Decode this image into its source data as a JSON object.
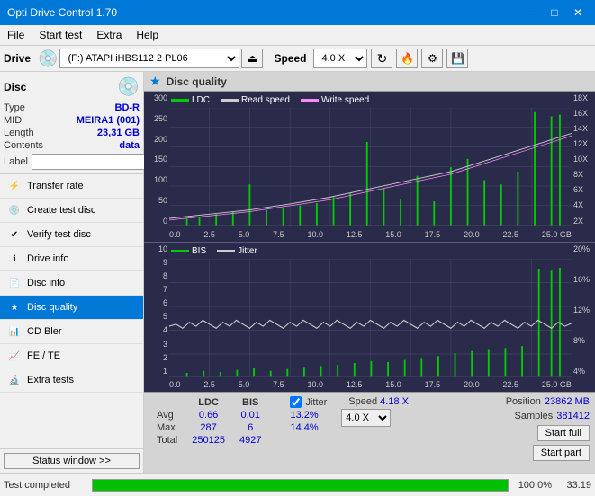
{
  "titlebar": {
    "title": "Opti Drive Control 1.70",
    "minimize": "─",
    "maximize": "□",
    "close": "✕"
  },
  "menubar": {
    "items": [
      "File",
      "Start test",
      "Extra",
      "Help"
    ]
  },
  "toolbar": {
    "drive_label": "Drive",
    "drive_value": "(F:)  ATAPI iHBS112  2 PL06",
    "speed_label": "Speed",
    "speed_value": "4.0 X"
  },
  "disc": {
    "header": "Disc",
    "type_label": "Type",
    "type_value": "BD-R",
    "mid_label": "MID",
    "mid_value": "MEIRA1 (001)",
    "length_label": "Length",
    "length_value": "23,31 GB",
    "contents_label": "Contents",
    "contents_value": "data",
    "label_label": "Label",
    "label_value": ""
  },
  "nav": {
    "items": [
      {
        "id": "transfer-rate",
        "label": "Transfer rate",
        "icon": "⚡"
      },
      {
        "id": "create-test-disc",
        "label": "Create test disc",
        "icon": "💿"
      },
      {
        "id": "verify-test-disc",
        "label": "Verify test disc",
        "icon": "✔"
      },
      {
        "id": "drive-info",
        "label": "Drive info",
        "icon": "ℹ"
      },
      {
        "id": "disc-info",
        "label": "Disc info",
        "icon": "📄"
      },
      {
        "id": "disc-quality",
        "label": "Disc quality",
        "icon": "★",
        "active": true
      },
      {
        "id": "cd-bler",
        "label": "CD Bler",
        "icon": "📊"
      },
      {
        "id": "fe-te",
        "label": "FE / TE",
        "icon": "📈"
      },
      {
        "id": "extra-tests",
        "label": "Extra tests",
        "icon": "🔬"
      }
    ]
  },
  "chart": {
    "title": "Disc quality",
    "top": {
      "legend": [
        {
          "label": "LDC",
          "color": "#00cc00"
        },
        {
          "label": "Read speed",
          "color": "#cccccc"
        },
        {
          "label": "Write speed",
          "color": "#ff88ff"
        }
      ],
      "y_left": [
        "300",
        "250",
        "200",
        "150",
        "100",
        "50",
        "0"
      ],
      "y_right": [
        "18X",
        "16X",
        "14X",
        "12X",
        "10X",
        "8X",
        "6X",
        "4X",
        "2X"
      ],
      "x_labels": [
        "0.0",
        "2.5",
        "5.0",
        "7.5",
        "10.0",
        "12.5",
        "15.0",
        "17.5",
        "20.0",
        "22.5",
        "25.0 GB"
      ]
    },
    "bottom": {
      "legend": [
        {
          "label": "BIS",
          "color": "#00cc00"
        },
        {
          "label": "Jitter",
          "color": "#cccccc"
        }
      ],
      "y_left": [
        "10",
        "9",
        "8",
        "7",
        "6",
        "5",
        "4",
        "3",
        "2",
        "1"
      ],
      "y_right": [
        "20%",
        "16%",
        "12%",
        "8%",
        "4%"
      ],
      "x_labels": [
        "0.0",
        "2.5",
        "5.0",
        "7.5",
        "10.0",
        "12.5",
        "15.0",
        "17.5",
        "20.0",
        "22.5",
        "25.0 GB"
      ]
    }
  },
  "stats": {
    "col_headers": [
      "",
      "LDC",
      "BIS"
    ],
    "rows": [
      {
        "label": "Avg",
        "ldc": "0.66",
        "bis": "0.01"
      },
      {
        "label": "Max",
        "ldc": "287",
        "bis": "6"
      },
      {
        "label": "Total",
        "ldc": "250125",
        "bis": "4927"
      }
    ],
    "jitter_label": "Jitter",
    "jitter_avg": "13.2%",
    "jitter_max": "14.4%",
    "speed_label": "Speed",
    "speed_value": "4.18 X",
    "speed_select": "4.0 X",
    "position_label": "Position",
    "position_value": "23862 MB",
    "samples_label": "Samples",
    "samples_value": "381412",
    "start_full": "Start full",
    "start_part": "Start part"
  },
  "statusbar": {
    "button": "Status window >>",
    "progress": 100,
    "progress_text": "100.0%",
    "time": "33:19",
    "status_text": "Test completed"
  },
  "colors": {
    "accent": "#0078d7",
    "ldc_bar": "#00cc00",
    "read_speed_line": "#cccccc",
    "write_speed_line": "#ff88ff",
    "bis_bar": "#00cc00",
    "jitter_line": "#ff88ff",
    "chart_bg": "#2a2a4a",
    "chart_grid": "#4a4a6a"
  }
}
